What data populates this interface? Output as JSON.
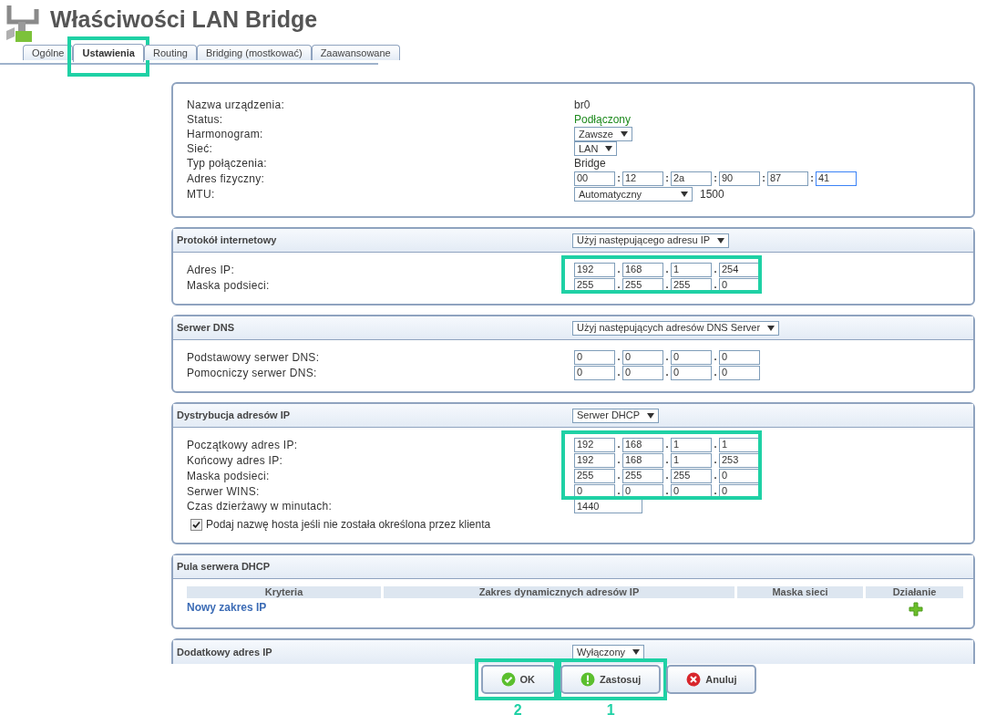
{
  "header": {
    "title": "Właściwości LAN Bridge"
  },
  "tabs": [
    {
      "label": "Ogólne",
      "selected": false,
      "highlighted": false
    },
    {
      "label": "Ustawienia",
      "selected": true,
      "highlighted": true
    },
    {
      "label": "Routing",
      "selected": false,
      "highlighted": false
    },
    {
      "label": "Bridging (mostkować)",
      "selected": false,
      "highlighted": false
    },
    {
      "label": "Zaawansowane",
      "selected": false,
      "highlighted": false
    }
  ],
  "device": {
    "rows": [
      {
        "label": "Nazwa urządzenia:",
        "kind": "text",
        "value": "br0"
      },
      {
        "label": "Status:",
        "kind": "status",
        "value": "Podłączony"
      },
      {
        "label": "Harmonogram:",
        "kind": "select",
        "value": "Zawsze"
      },
      {
        "label": "Sieć:",
        "kind": "select",
        "value": "LAN"
      },
      {
        "label": "Typ połączenia:",
        "kind": "text",
        "value": "Bridge"
      },
      {
        "label": "Adres fizyczny:",
        "kind": "octets",
        "separator": ":",
        "octets": [
          "00",
          "12",
          "2a",
          "90",
          "87",
          "41"
        ]
      },
      {
        "label": "MTU:",
        "kind": "select_wide",
        "value": "Automatyczny",
        "extra": "1500"
      }
    ]
  },
  "sections": [
    {
      "title": "Protokół internetowy",
      "select": "Użyj następującego adresu IP",
      "rows": [
        {
          "label": "Adres IP:",
          "kind": "octets",
          "separator": ".",
          "octets": [
            "192",
            "168",
            "1",
            "254"
          ],
          "highlighted": true
        },
        {
          "label": "Maska podsieci:",
          "kind": "octets",
          "separator": ".",
          "octets": [
            "255",
            "255",
            "255",
            "0"
          ],
          "highlighted": true
        }
      ]
    },
    {
      "title": "Serwer DNS",
      "select": "Użyj następujących adresów DNS Server",
      "rows": [
        {
          "label": "Podstawowy serwer DNS:",
          "kind": "octets",
          "separator": ".",
          "octets": [
            "0",
            "0",
            "0",
            "0"
          ]
        },
        {
          "label": "Pomocniczy serwer DNS:",
          "kind": "octets",
          "separator": ".",
          "octets": [
            "0",
            "0",
            "0",
            "0"
          ]
        }
      ]
    },
    {
      "title": "Dystrybucja adresów IP",
      "select": "Serwer DHCP",
      "rows": [
        {
          "label": "Początkowy adres IP:",
          "kind": "octets",
          "separator": ".",
          "octets": [
            "192",
            "168",
            "1",
            "1"
          ],
          "highlighted": true
        },
        {
          "label": "Końcowy adres IP:",
          "kind": "octets",
          "separator": ".",
          "octets": [
            "192",
            "168",
            "1",
            "253"
          ],
          "highlighted": true
        },
        {
          "label": "Maska podsieci:",
          "kind": "octets",
          "separator": ".",
          "octets": [
            "255",
            "255",
            "255",
            "0"
          ],
          "highlighted": true
        },
        {
          "label": "Serwer WINS:",
          "kind": "octets",
          "separator": ".",
          "octets": [
            "0",
            "0",
            "0",
            "0"
          ],
          "highlighted": true
        },
        {
          "label": "Czas dzierżawy w minutach:",
          "kind": "input",
          "value": "1440"
        }
      ],
      "checkbox": {
        "label": "Podaj nazwę hosta jeśli nie została określona przez klienta",
        "checked": true
      }
    }
  ],
  "pool": {
    "title": "Pula serwera DHCP",
    "columns": [
      "Kryteria",
      "Zakres dynamicznych adresów IP",
      "Maska sieci",
      "Działanie"
    ],
    "link": "Nowy zakres IP"
  },
  "extra": {
    "title": "Dodatkowy adres IP",
    "select": "Wyłączony"
  },
  "buttons": [
    {
      "label": "OK",
      "kind": "ok",
      "highlighted": true,
      "marker": "2"
    },
    {
      "label": "Zastosuj",
      "kind": "apply",
      "highlighted": true,
      "marker": "1"
    },
    {
      "label": "Anuluj",
      "kind": "cancel"
    }
  ]
}
